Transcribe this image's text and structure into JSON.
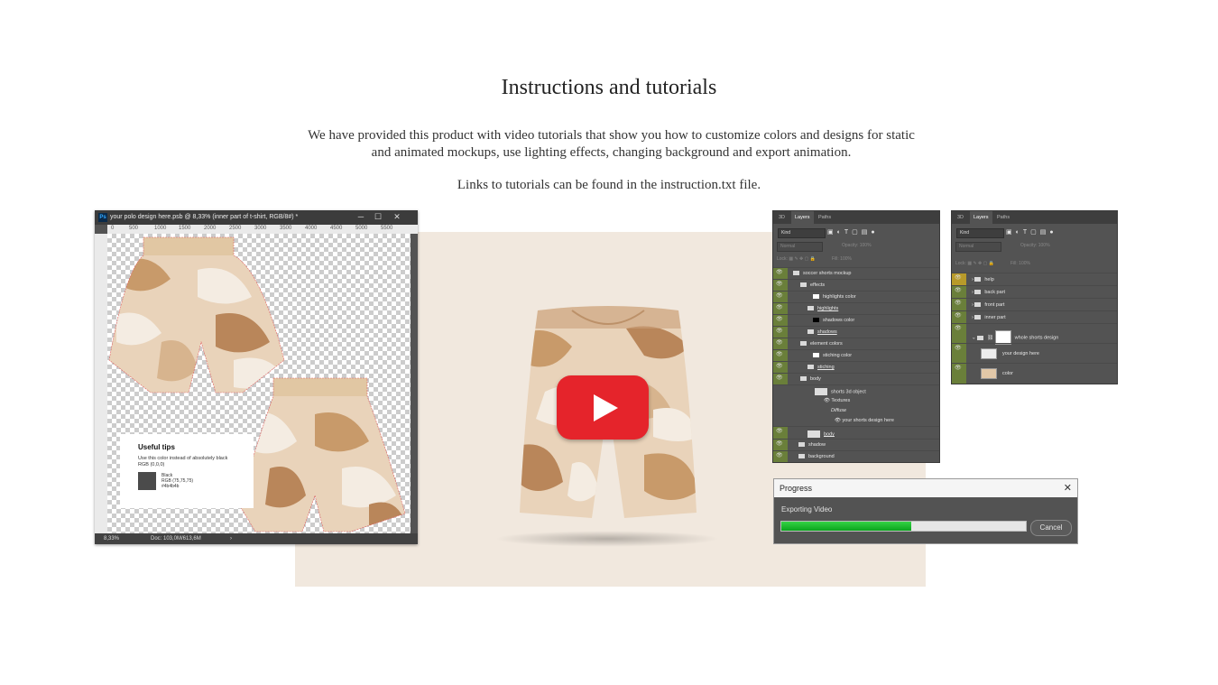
{
  "section": {
    "title": "Instructions and tutorials",
    "description": "We have provided this product with video tutorials that show you how to customize colors and designs for static and animated mockups, use lighting effects, changing background and export animation.",
    "links_note": "Links to tutorials can be found in the instruction.txt file."
  },
  "colors": {
    "background": "#ffffff",
    "panel_beige": "#f1e8de",
    "play_red": "#e5242b",
    "eye_green": "#6a7f3a",
    "progress_green": "#18c02f"
  },
  "photoshop_window": {
    "app_icon": "Ps",
    "title": "your polo design here.psb @ 8,33% (inner part of t-shirt, RGB/8#) *",
    "controls": [
      "─",
      "☐",
      "✕"
    ],
    "ruler_ticks": [
      "0",
      "500",
      "1000",
      "1500",
      "2000",
      "2500",
      "3000",
      "3500",
      "4000",
      "4500",
      "5000",
      "5500"
    ],
    "zoom": "8,33%",
    "doc_info": "Doc: 103,0M/613,6M",
    "useful_tips": {
      "title": "Useful tips",
      "description": "Use this color instead of absolutely black RGB (0,0,0)",
      "swatch_name": "Black",
      "swatch_rgb": "RGB (75,75,75)",
      "swatch_hex": "#4b4b4b"
    }
  },
  "video": {
    "play_icon": "play-icon"
  },
  "layers_panel_1": {
    "tabs": [
      "3D",
      "Layers",
      "Paths"
    ],
    "filter": "Kind",
    "blend_mode": "Normal",
    "opacity": "Opacity: 100%",
    "lock": "Lock:",
    "fill": "Fill: 100%",
    "layers": [
      "soccer shorts mockup",
      "effects",
      "highlights color",
      "highlights",
      "shadows color",
      "shadows",
      "element colors",
      "stiching color",
      "stiching",
      "body",
      "shorts 3d object",
      "Textures",
      "Diffuse",
      "your shorts design here",
      "body",
      "shadow",
      "background"
    ]
  },
  "layers_panel_2": {
    "tabs": [
      "3D",
      "Layers",
      "Paths"
    ],
    "filter": "Kind",
    "blend_mode": "Normal",
    "opacity": "Opacity: 100%",
    "lock": "Lock:",
    "fill": "Fill: 100%",
    "layers": [
      "help",
      "back part",
      "front part",
      "inner part",
      "whole shorts design",
      "your design here",
      "color"
    ]
  },
  "progress_dialog": {
    "title": "Progress",
    "status": "Exporting Video",
    "progress": 0.53,
    "cancel_label": "Cancel"
  }
}
